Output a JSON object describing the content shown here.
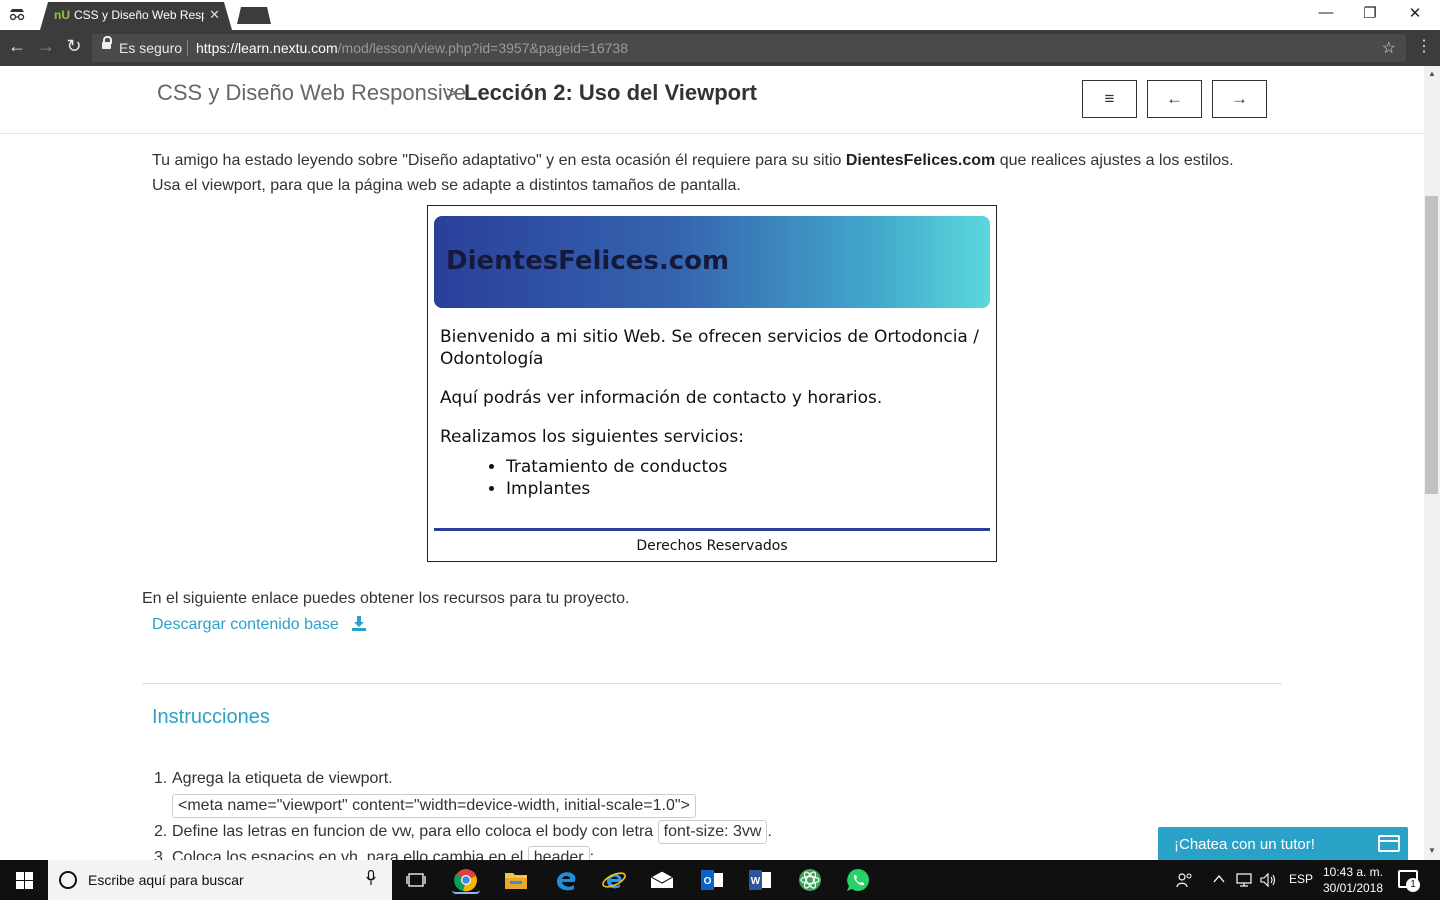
{
  "browser": {
    "tab_title": "CSS y Diseño Web Respo",
    "tab_favicon_text": "nU",
    "tab_close": "✕",
    "window": {
      "minimize": "—",
      "maximize": "❐",
      "close": "✕"
    },
    "nav": {
      "back": "←",
      "forward": "→",
      "reload": "↻"
    },
    "secure_label": "Es seguro",
    "url_scheme_host": "https://learn.nextu.com",
    "url_path": "/mod/lesson/view.php?id=3957&pageid=16738",
    "star": "☆",
    "menu": "⋮"
  },
  "header": {
    "course_title": "CSS y Diseño Web Responsive",
    "separator": ">",
    "lesson_title": "Lección 2: Uso del Viewport",
    "menu_button": "≡",
    "prev_button": "←",
    "next_button": "→"
  },
  "content": {
    "intro_part1": "Tu amigo ha estado leyendo sobre \"Diseño adaptativo\" y en esta ocasión él requiere para su sitio ",
    "intro_bold": "DientesFelices.com",
    "intro_part2": " que realices ajustes a los estilos.",
    "intro_line2": "Usa el viewport, para que la página web se adapte a distintos tamaños de pantalla.",
    "preview": {
      "site_name": "DientesFelices.com",
      "welcome": "Bienvenido a mi sitio Web. Se ofrecen servicios de Ortodoncia / Odontología",
      "info": "Aquí podrás ver información de contacto y horarios.",
      "services_intro": "Realizamos los siguientes servicios:",
      "services": [
        "Tratamiento de conductos",
        "Implantes"
      ],
      "footer": "Derechos Reservados"
    },
    "resources_text": "En el siguiente enlace puedes obtener los recursos para tu proyecto.",
    "download_link": "Descargar contenido base",
    "instructions_title": "Instrucciones",
    "steps": [
      {
        "num": "1.",
        "text": "Agrega la etiqueta de viewport.",
        "code": "<meta name=\"viewport\" content=\"width=device-width, initial-scale=1.0\">"
      },
      {
        "num": "2.",
        "text": "Define las letras en funcion de vw, para ello coloca el body con letra ",
        "code": "font-size: 3vw",
        "suffix": "."
      },
      {
        "num": "3.",
        "text": "Coloca los espacios en vh, para ello cambia en el ",
        "code": "header",
        "suffix": ":"
      }
    ],
    "chat_label": "¡Chatea con un tutor!"
  },
  "taskbar": {
    "search_placeholder": "Escribe aquí para buscar",
    "language": "ESP",
    "time": "10:43 a. m.",
    "date": "30/01/2018",
    "notifications_count": "1"
  }
}
